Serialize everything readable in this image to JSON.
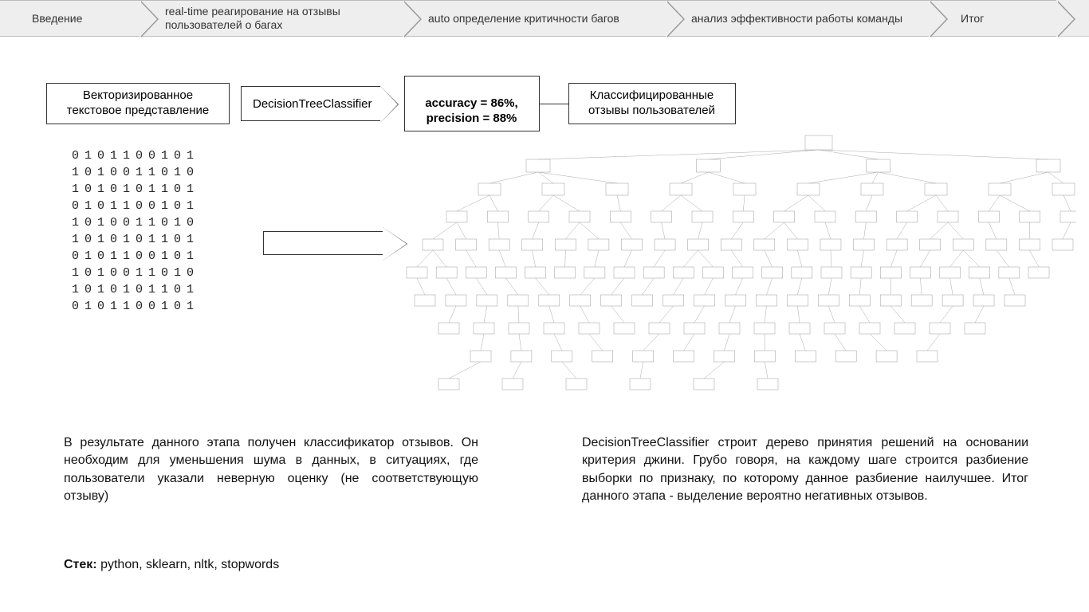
{
  "nav": {
    "items": [
      "Введение",
      "real-time реагирование на отзывы пользователей о багах",
      "auto определение критичности багов",
      "анализ эффективности работы команды",
      "Итог"
    ]
  },
  "flow": {
    "vector_box": "Векторизированное текстовое представление",
    "classifier_arrow": "DecisionTreeClassifier",
    "metrics_box": "accuracy = 86%,\nprecision = 88%",
    "output_box": "Классифицированные отзывы пользователей"
  },
  "matrix": {
    "rows": [
      "0101100101",
      "1010011010",
      "1010101101",
      "0101100101",
      "1010011010",
      "1010101101",
      "0101100101",
      "1010011010",
      "1010101101",
      "0101100101"
    ]
  },
  "paragraphs": {
    "left": "В результате данного этапа получен классификатор отзывов. Он необходим для уменьшения шума в данных, в ситуациях, где пользователи указали неверную оценку (не соответствующую отзыву)",
    "right": "DecisionTreeClassifier строит дерево принятия решений на основании критерия джини. Грубо говоря, на каждому шаге строится разбиение выборки по признаку, по которому данное разбиение наилучшее. Итог данного этапа - выделение вероятно негативных отзывов."
  },
  "stack": {
    "label": "Стек:",
    "value": "python, sklearn, nltk, stopwords"
  }
}
